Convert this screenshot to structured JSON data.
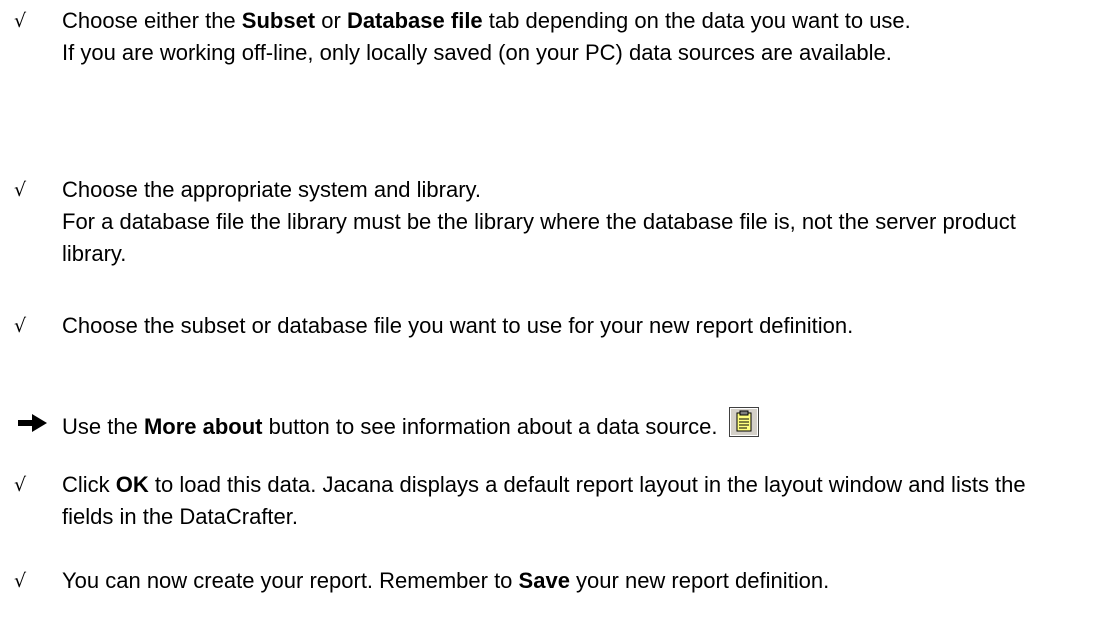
{
  "items": [
    {
      "marker": "√",
      "parts": [
        "Choose either the ",
        "Subset",
        " or ",
        "Database file",
        " tab depending on the data you want to use."
      ],
      "extra": "If you are working off-line, only locally saved (on your PC) data sources are available."
    },
    {
      "marker": "√",
      "line1": "Choose the appropriate system and library.",
      "line2": "For a database file the library must be the library where the database file is, not the server product library."
    },
    {
      "marker": "√",
      "text": "Choose the subset or database file you want to use for your new report definition."
    },
    {
      "marker_icon": "right-arrow-icon",
      "parts": [
        "Use the ",
        "More about",
        " button to see information about a data source."
      ],
      "button_icon": "notepad-icon"
    },
    {
      "marker": "√",
      "parts": [
        "Click ",
        "OK",
        " to load this data. Jacana displays a default report layout in the layout window and lists the fields in the DataCrafter."
      ]
    },
    {
      "marker": "√",
      "parts": [
        "You can now create your report. Remember to ",
        "Save",
        " your new report definition."
      ]
    }
  ]
}
